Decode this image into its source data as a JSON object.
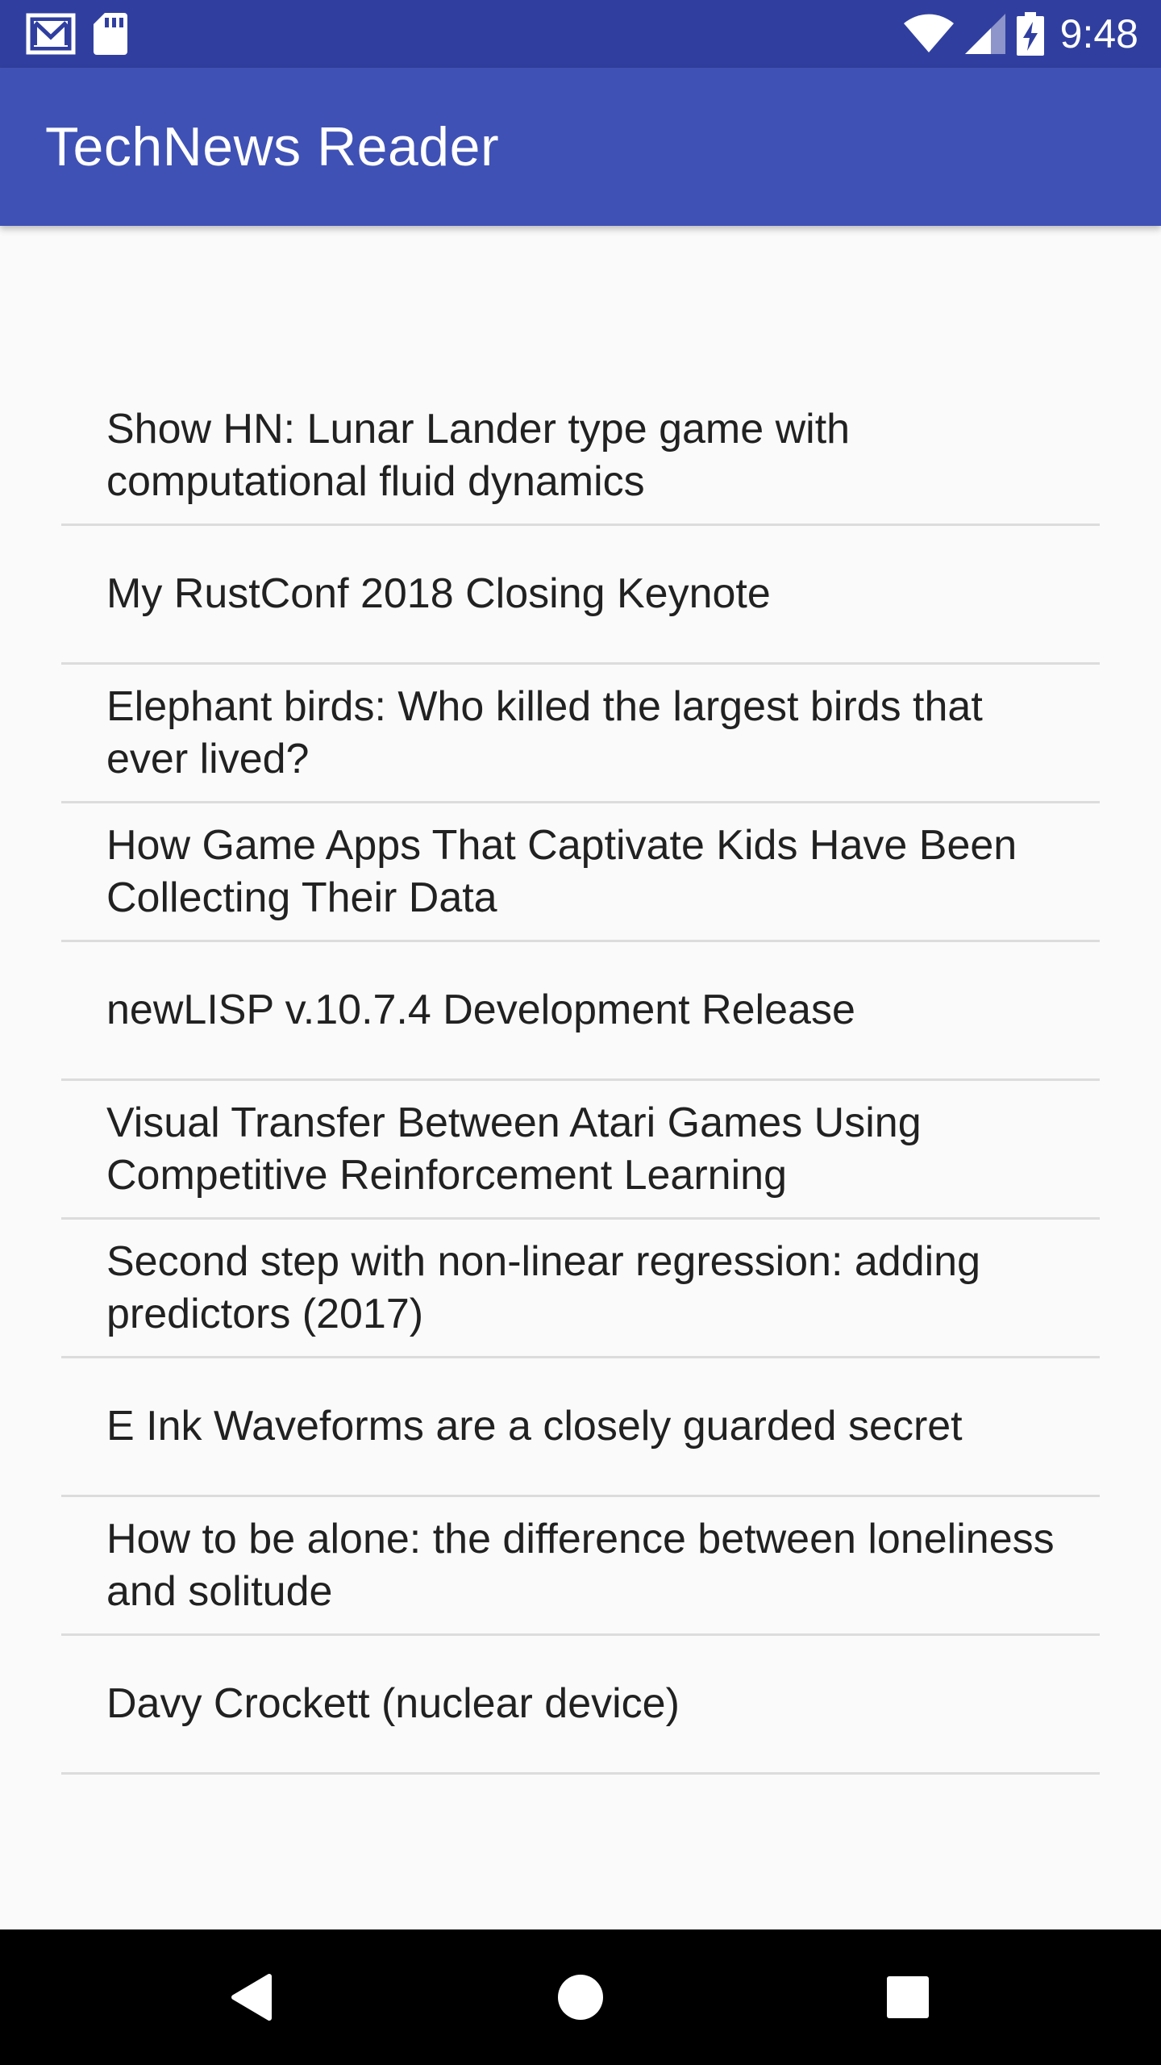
{
  "status_bar": {
    "time": "9:48",
    "icons_left": [
      "gmail-icon",
      "sd-card-icon"
    ],
    "icons_right": [
      "wifi-icon",
      "cell-signal-icon",
      "battery-charging-icon"
    ]
  },
  "app_bar": {
    "title": "TechNews Reader",
    "color": "#3f51b5",
    "status_color": "#303f9f"
  },
  "news": {
    "items": [
      {
        "title": "Show HN: Lunar Lander type game with computational fluid dynamics"
      },
      {
        "title": "My RustConf 2018 Closing Keynote"
      },
      {
        "title": "Elephant birds: Who killed the largest birds that ever lived?"
      },
      {
        "title": "How Game Apps That Captivate Kids Have Been Collecting Their Data"
      },
      {
        "title": "newLISP v.10.7.4 Development Release"
      },
      {
        "title": "Visual Transfer Between Atari Games Using Competitive Reinforcement Learning"
      },
      {
        "title": "Second step with non-linear regression: adding predictors (2017)"
      },
      {
        "title": "E Ink Waveforms are a closely guarded secret"
      },
      {
        "title": "How to be alone: the difference between loneliness and solitude"
      },
      {
        "title": "Davy Crockett (nuclear device)"
      }
    ]
  },
  "nav_bar": {
    "icons": [
      "back-icon",
      "home-icon",
      "recents-icon"
    ]
  }
}
